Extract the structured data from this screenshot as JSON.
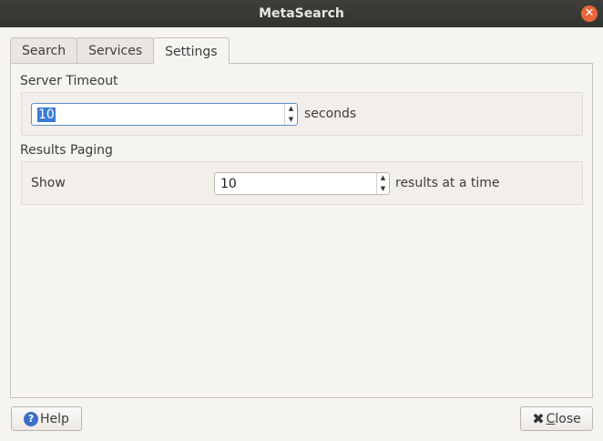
{
  "window": {
    "title": "MetaSearch"
  },
  "tabs": [
    {
      "label": "Search"
    },
    {
      "label": "Services"
    },
    {
      "label": "Settings"
    }
  ],
  "settings": {
    "server_timeout": {
      "label": "Server Timeout",
      "value": "10",
      "unit": "seconds"
    },
    "results_paging": {
      "label": "Results Paging",
      "show_label": "Show",
      "value": "10",
      "suffix": "results at a time"
    }
  },
  "footer": {
    "help_label": "Help",
    "close_label_first": "C",
    "close_label_rest": "lose"
  },
  "colors": {
    "titlebar": "#343330",
    "close_accent": "#e9643a",
    "selection": "#3a7bd5"
  }
}
